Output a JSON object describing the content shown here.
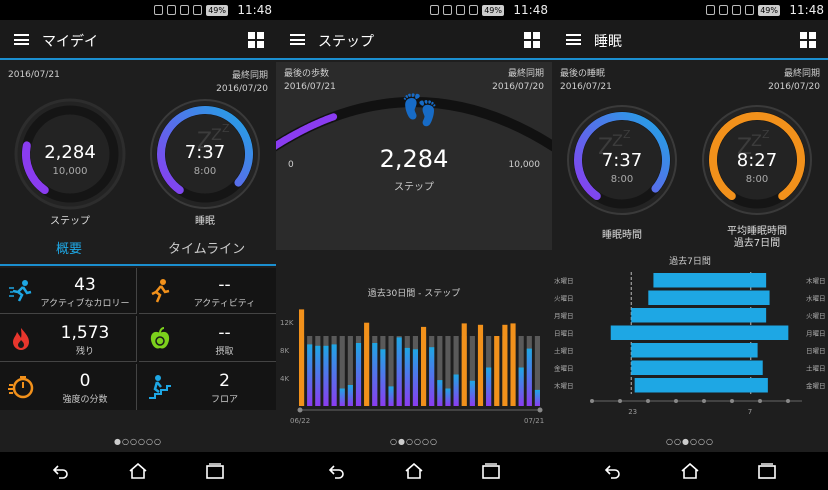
{
  "status": {
    "time": "11:48",
    "battery": "49%"
  },
  "panels": {
    "mydays": {
      "title": "マイデイ",
      "date_left": "2016/07/21",
      "sync_label": "最終同期",
      "sync_date": "2016/07/20",
      "steps": {
        "value": "2,284",
        "goal": "10,000",
        "label": "ステップ",
        "progress": 0.2284
      },
      "sleep": {
        "value": "7:37",
        "goal": "8:00",
        "label": "睡眠",
        "progress": 0.95
      },
      "tabs": [
        "概要",
        "タイムライン"
      ],
      "cells": [
        {
          "value": "43",
          "sub": "アクティブなカロリー",
          "icon": "running-person-icon",
          "color": "#1ea7e4"
        },
        {
          "value": "--",
          "sub": "アクティビティ",
          "icon": "runner-icon",
          "color": "#f2911b"
        },
        {
          "value": "1,573",
          "sub": "残り",
          "icon": "flame-icon",
          "color": "#e8362d"
        },
        {
          "value": "--",
          "sub": "摂取",
          "icon": "apple-icon",
          "color": "#7cd11c"
        },
        {
          "value": "0",
          "sub": "強度の分数",
          "icon": "stopwatch-icon",
          "color": "#f2911b"
        },
        {
          "value": "2",
          "sub": "フロア",
          "icon": "stairs-icon",
          "color": "#1ea7e4"
        }
      ],
      "page_dots": "●○○○○○"
    },
    "steps": {
      "title": "ステップ",
      "last_label": "最後の歩数",
      "last_date": "2016/07/21",
      "sync_label": "最終同期",
      "sync_date": "2016/07/20",
      "value": "2,284",
      "unit": "ステップ",
      "min": "0",
      "max": "10,000",
      "progress": 0.2284,
      "chart_title": "過去30日間 - ステップ",
      "page_dots": "○●○○○○"
    },
    "sleep": {
      "title": "睡眠",
      "last_label": "最後の睡眠",
      "last_date": "2016/07/21",
      "sync_label": "最終同期",
      "sync_date": "2016/07/20",
      "sleep_time": {
        "value": "7:37",
        "goal": "8:00",
        "label": "睡眠時間",
        "progress": 0.95
      },
      "avg": {
        "value": "8:27",
        "goal": "8:00",
        "label1": "平均睡眠時間",
        "label2": "過去7日間",
        "progress": 1.0
      },
      "chart_title": "過去7日間",
      "page_dots": "○○●○○○"
    }
  },
  "colors": {
    "accent": "#1b8fd0",
    "purple": "#8a3cf0",
    "orange": "#f2911b",
    "sleep_blue": "#1ea7e4"
  },
  "chart_data": [
    {
      "type": "bar",
      "title": "過去30日間 - ステップ",
      "ylim": [
        0,
        14000
      ],
      "yticks": [
        "4K",
        "8K",
        "12K"
      ],
      "x_start_label": "06/22",
      "x_end_label": "07/21",
      "series": [
        {
          "name": "",
          "values": [
            13800,
            8800,
            8600,
            8600,
            8800,
            2500,
            3000,
            9000,
            11900,
            9000,
            8100,
            2800,
            9800,
            8300,
            8100,
            11300,
            8400,
            3700,
            2500,
            4500,
            11800,
            3600,
            11600,
            5500,
            10000,
            11600,
            11800,
            5500,
            8200,
            2300
          ]
        }
      ],
      "goal_values": [
        10000,
        10000,
        10000,
        10000,
        10000,
        10000,
        10000,
        10000,
        10000,
        10000,
        10000,
        10000,
        10000,
        10000,
        10000,
        10000,
        10000,
        10000,
        10000,
        10000,
        10000,
        10000,
        10000,
        10000,
        10000,
        10000,
        10000,
        10000,
        10000,
        10000
      ]
    },
    {
      "type": "bar",
      "title": "過去7日間",
      "orientation": "horizontal",
      "categories_left": [
        "水曜日",
        "火曜日",
        "月曜日",
        "日曜日",
        "土曜日",
        "金曜日",
        "木曜日"
      ],
      "categories_right": [
        "木曜日",
        "水曜日",
        "火曜日",
        "月曜日",
        "日曜日",
        "土曜日",
        "金曜日"
      ],
      "x_labels": [
        "23",
        "7"
      ],
      "series": [
        {
          "name": "",
          "start": [
            1.3,
            1.0,
            0.0,
            -1.2,
            0.0,
            0.0,
            0.2
          ],
          "end": [
            7.9,
            8.1,
            7.9,
            9.2,
            7.4,
            7.7,
            8.0
          ]
        }
      ]
    }
  ]
}
